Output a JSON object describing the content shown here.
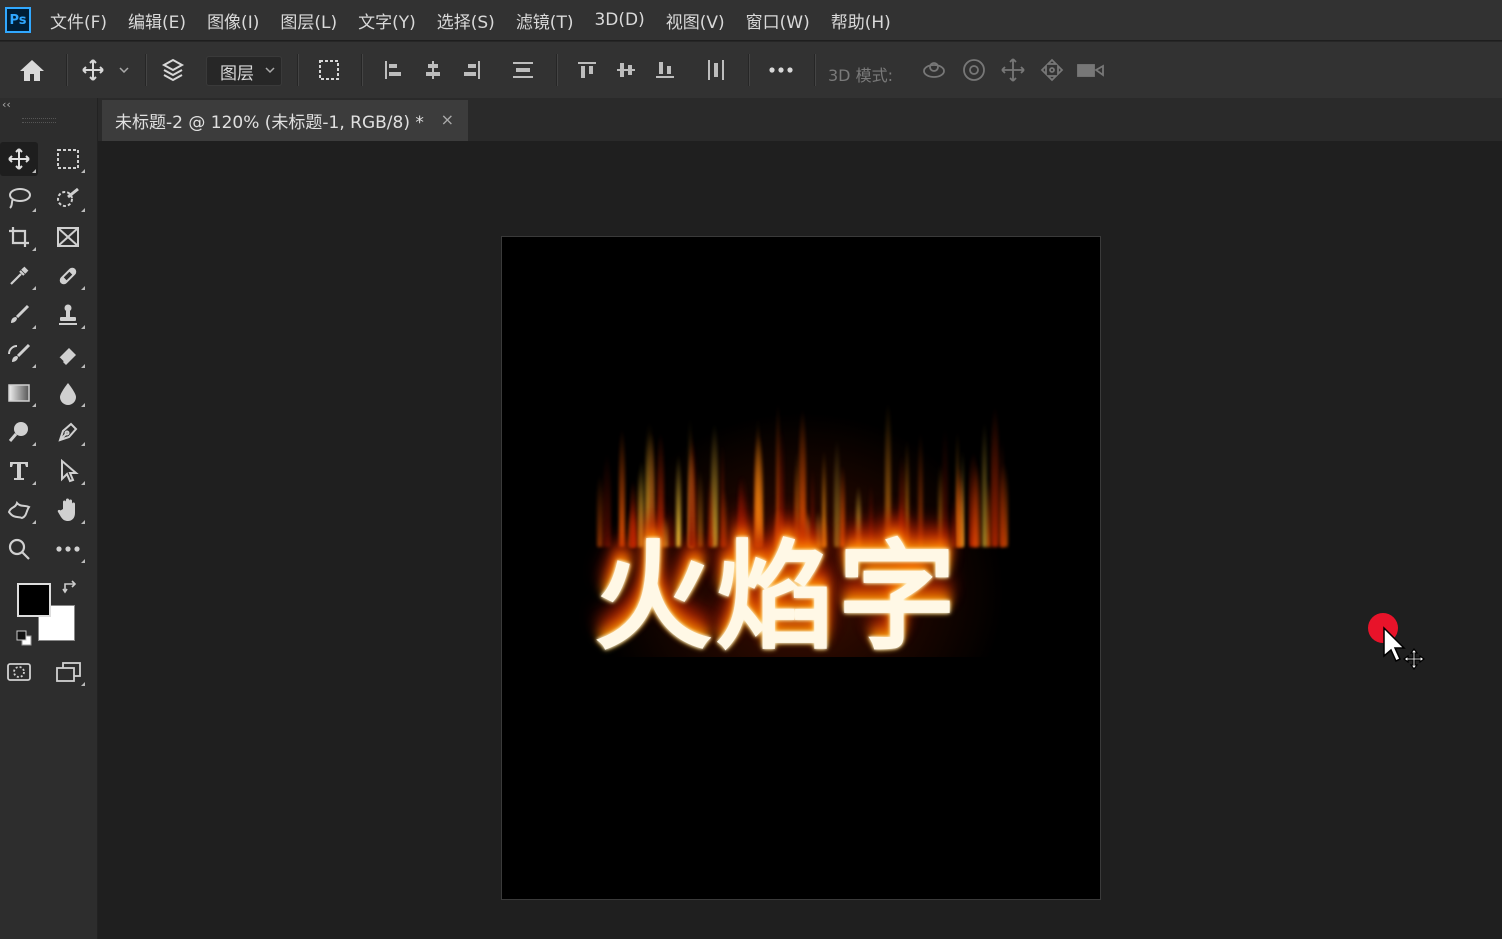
{
  "app": {
    "logo": "Ps",
    "brand_color": "#31a8ff"
  },
  "menu": [
    "文件(F)",
    "编辑(E)",
    "图像(I)",
    "图层(L)",
    "文字(Y)",
    "选择(S)",
    "滤镜(T)",
    "3D(D)",
    "视图(V)",
    "窗口(W)",
    "帮助(H)"
  ],
  "options": {
    "icons": [
      "home-icon",
      "move-tool-icon",
      "chevron-down-icon",
      "auto-select-layer-icon",
      "transform-controls-icon",
      "align-left-icon",
      "align-horizontal-center-icon",
      "align-right-icon",
      "distribute-vertical-icon",
      "align-top-icon",
      "align-vertical-center-icon",
      "align-bottom-icon",
      "distribute-horizontal-icon",
      "more-icon",
      "3d-orbit-icon",
      "3d-roll-icon",
      "3d-pan-icon",
      "3d-slide-icon",
      "3d-camera-icon"
    ],
    "auto_select_value": "图层",
    "mode_3d_label": "3D 模式:"
  },
  "toolbar": {
    "collapse_label": "‹‹",
    "tools": [
      "move-tool",
      "rectangular-marquee-tool",
      "lasso-tool",
      "quick-selection-tool",
      "crop-tool",
      "frame-tool",
      "eyedropper-tool",
      "spot-healing-brush-tool",
      "brush-tool",
      "clone-stamp-tool",
      "history-brush-tool",
      "eraser-tool",
      "gradient-tool",
      "blur-tool",
      "dodge-tool",
      "pen-tool",
      "type-tool",
      "path-selection-tool",
      "custom-shape-tool",
      "hand-tool",
      "zoom-tool",
      "edit-toolbar"
    ],
    "foreground_color": "#000000",
    "background_color": "#ffffff"
  },
  "document": {
    "tab_title": "未标题-2 @ 120% (未标题-1, RGB/8) *",
    "close_glyph": "×",
    "canvas_text": "火焰字",
    "canvas_background": "#000000"
  },
  "cursor": {
    "click_indicator_color": "#e8132a"
  }
}
